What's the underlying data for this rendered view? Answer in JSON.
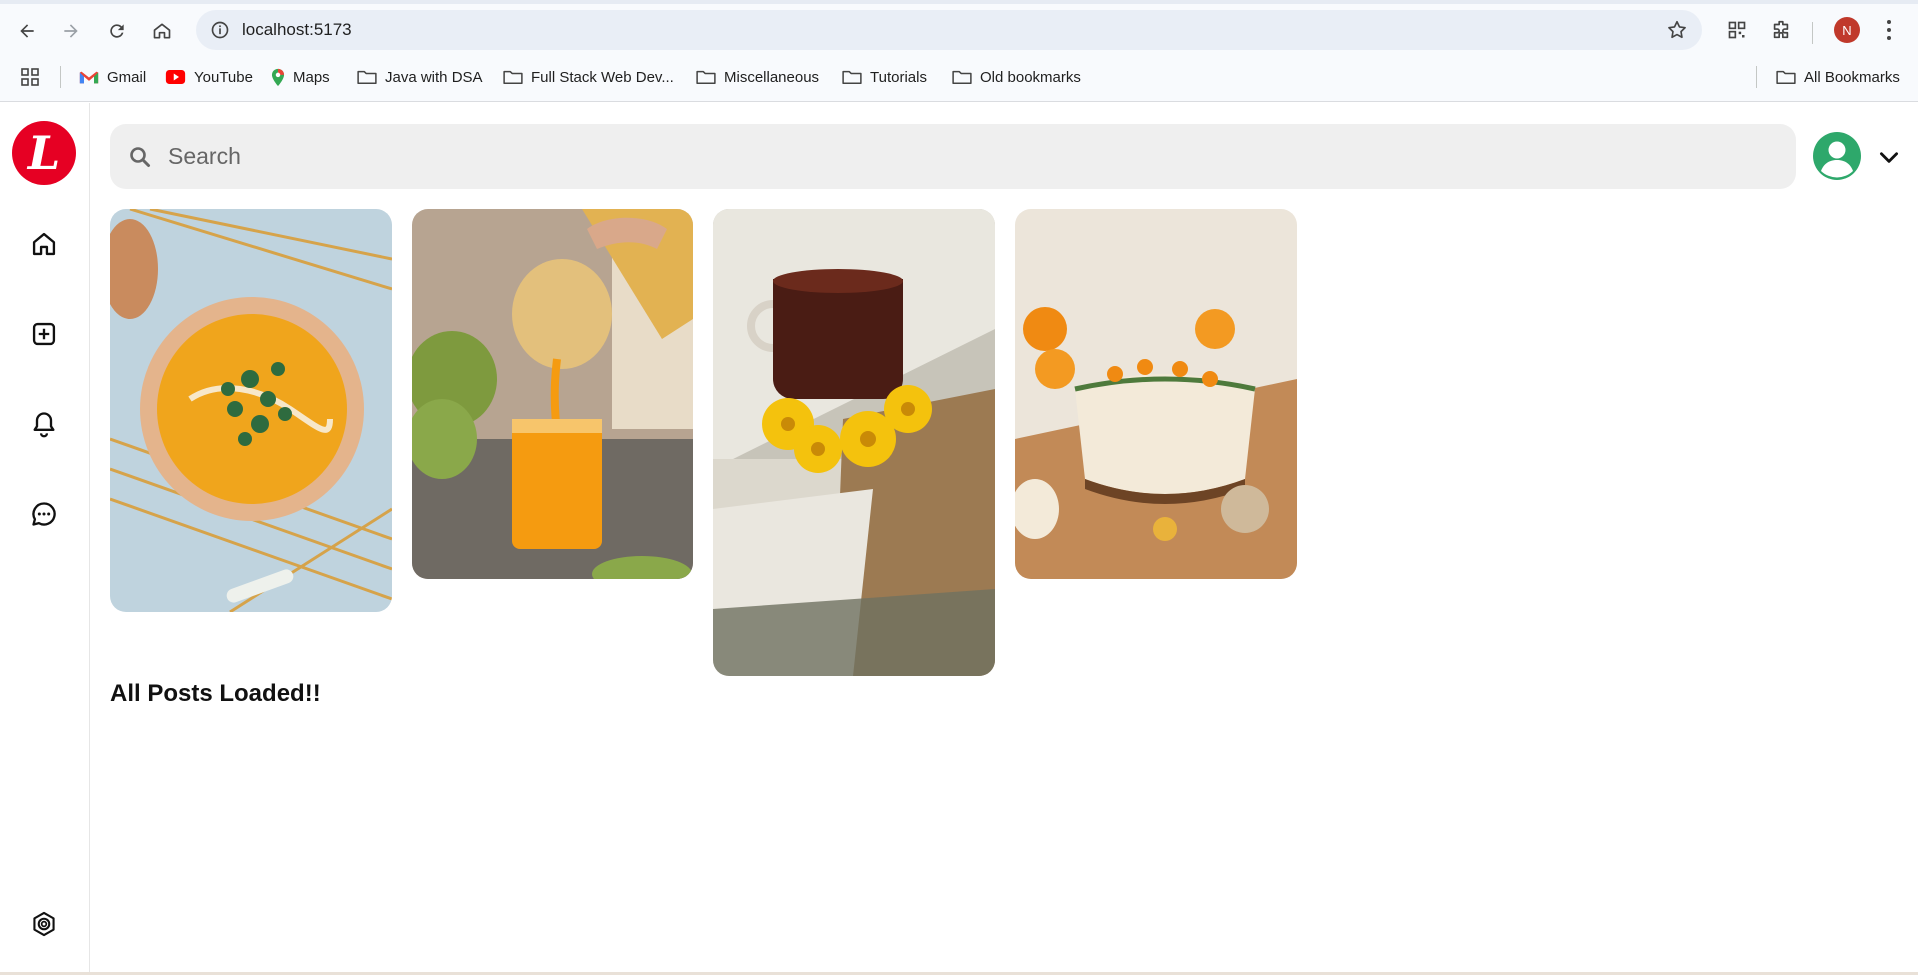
{
  "browser": {
    "url": "localhost:5173",
    "profile_initial": "N",
    "bookmarks": [
      {
        "label": "Gmail",
        "icon": "gmail-icon"
      },
      {
        "label": "YouTube",
        "icon": "youtube-icon"
      },
      {
        "label": "Maps",
        "icon": "maps-icon"
      },
      {
        "label": "Java with DSA",
        "icon": "folder-icon"
      },
      {
        "label": "Full Stack Web Dev...",
        "icon": "folder-icon"
      },
      {
        "label": "Miscellaneous",
        "icon": "folder-icon"
      },
      {
        "label": "Tutorials",
        "icon": "folder-icon"
      },
      {
        "label": "Old bookmarks",
        "icon": "folder-icon"
      }
    ],
    "all_bookmarks": "All Bookmarks"
  },
  "app": {
    "logo_letter": "L",
    "brand_color": "#e60023",
    "sidebar": [
      "home-icon",
      "create-icon",
      "notifications-icon",
      "messages-icon",
      "settings-icon"
    ],
    "search": {
      "placeholder": "Search"
    },
    "pins": [
      {
        "subject": "pumpkin soup bowl"
      },
      {
        "subject": "pouring orange juice"
      },
      {
        "subject": "tea with yellow flowers"
      },
      {
        "subject": "cheesecake with oranges"
      }
    ],
    "status_text": "All Posts Loaded!!"
  }
}
